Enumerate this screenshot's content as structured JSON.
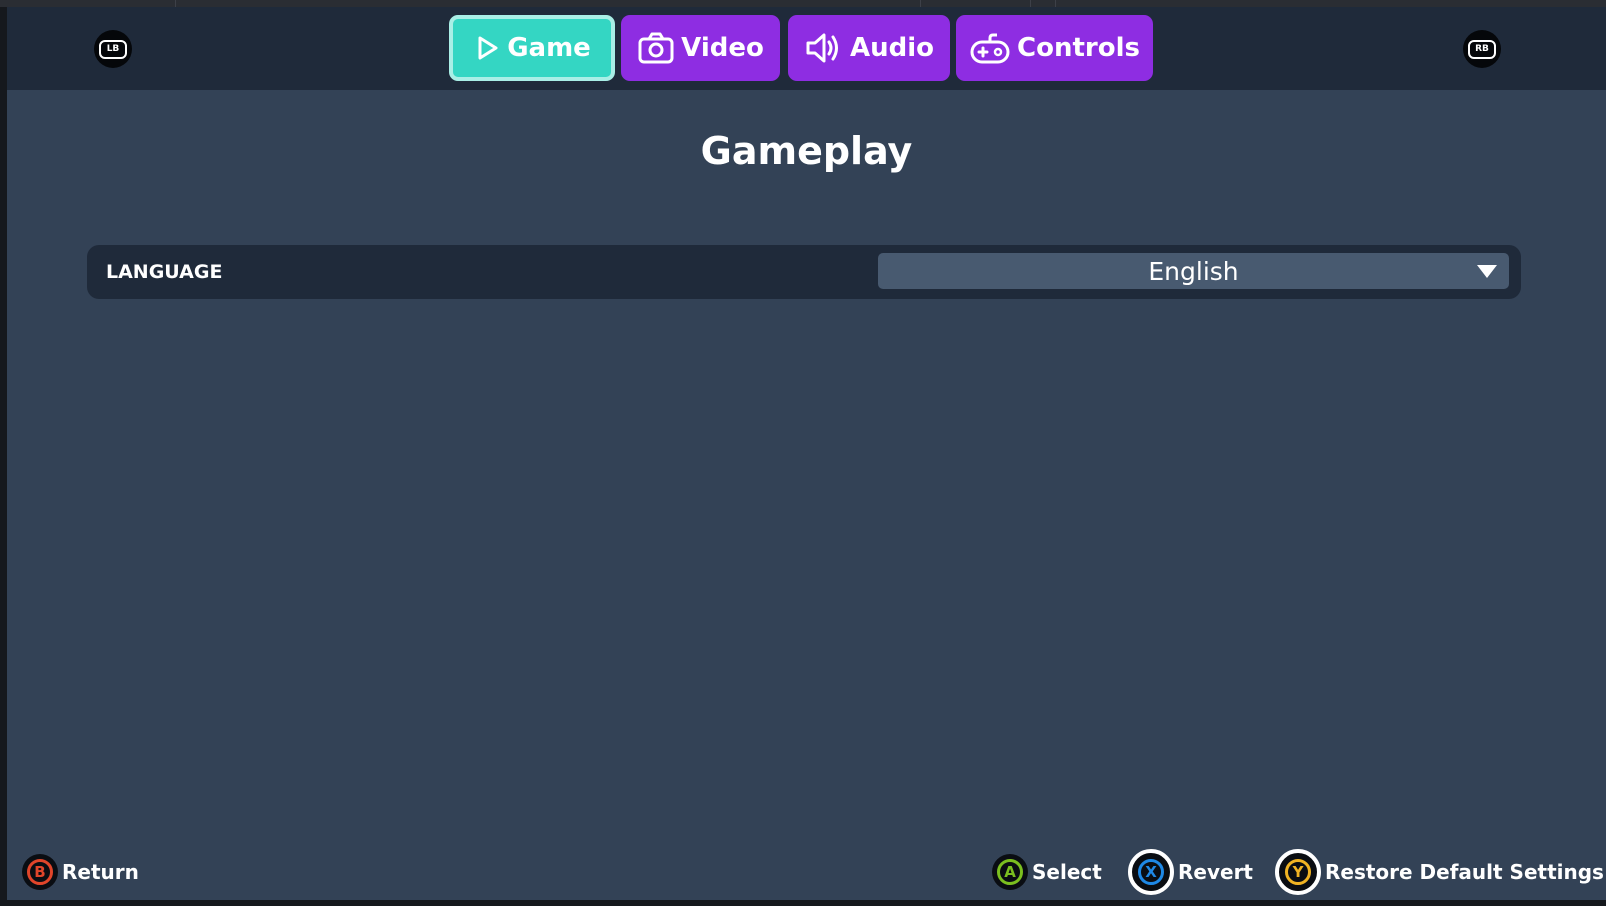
{
  "header": {
    "left_bumper": "LB",
    "right_bumper": "RB",
    "tabs": [
      {
        "label": "Game",
        "icon": "play-icon",
        "active": true
      },
      {
        "label": "Video",
        "icon": "camera-icon",
        "active": false
      },
      {
        "label": "Audio",
        "icon": "speaker-icon",
        "active": false
      },
      {
        "label": "Controls",
        "icon": "gamepad-icon",
        "active": false
      }
    ]
  },
  "main": {
    "section_title": "Gameplay",
    "settings": [
      {
        "label": "LANGUAGE",
        "value": "English",
        "control": "dropdown"
      }
    ]
  },
  "footer": {
    "return": {
      "button": "B",
      "label": "Return",
      "color": "#e0452a"
    },
    "select": {
      "button": "A",
      "label": "Select",
      "color": "#7bbf1f"
    },
    "revert": {
      "button": "X",
      "label": "Revert",
      "color": "#1e88e5"
    },
    "restore": {
      "button": "Y",
      "label": "Restore Default Settings",
      "color": "#f0b323"
    }
  },
  "colors": {
    "tab_inactive": "#8e2de2",
    "tab_active": "#34d6c3",
    "panel_bg": "#334256",
    "bar_bg": "#1f2a3a"
  }
}
